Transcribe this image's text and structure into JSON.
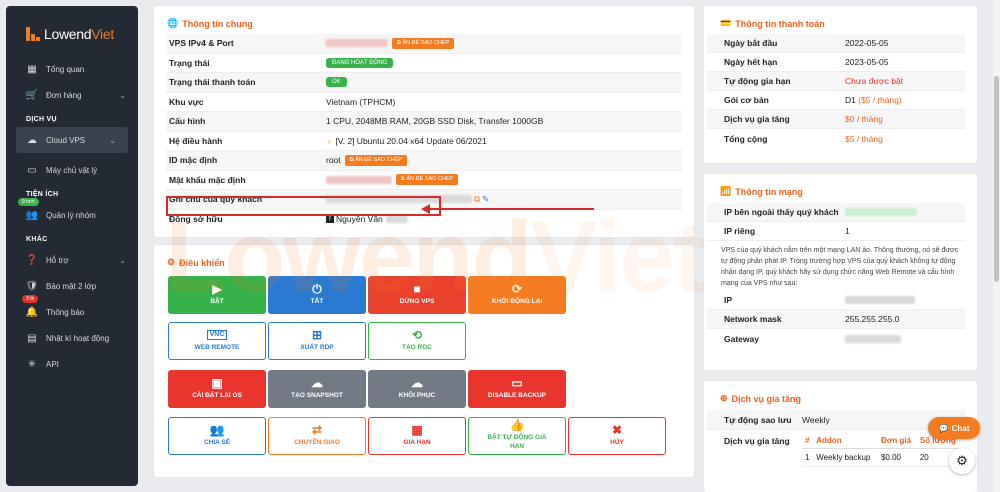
{
  "brand": {
    "name_a": "Lowend",
    "name_b": "Viet"
  },
  "sidebar": {
    "overview": "Tổng quan",
    "orders": "Đơn hàng",
    "section_services": "DỊCH VỤ",
    "cloud_vps": "Cloud VPS",
    "dedicated": "Máy chủ vật lý",
    "section_utilities": "TIỆN ÍCH",
    "group_manage": "Quản lý nhóm",
    "group_badge": "9 mới",
    "section_other": "KHÁC",
    "support": "Hỗ trợ",
    "two_factor": "Bảo mật 2 lớp",
    "notifications": "Thông báo",
    "notif_badge": "3 tb",
    "activity_log": "Nhật kí hoạt động",
    "api": "API"
  },
  "general": {
    "title": "Thông tin chung",
    "copy_label": "ẤN ĐỂ SAO CHÉP",
    "rows": {
      "ip": "VPS IPv4 & Port",
      "status": "Trạng thái",
      "status_value": "ĐANG HOẠT ĐỘNG",
      "payment": "Trạng thái thanh toán",
      "payment_value": "OK",
      "region": "Khu vực",
      "region_value": "Vietnam (TPHCM)",
      "config": "Cấu hình",
      "config_value": "1 CPU, 2048MB RAM, 20GB SSD Disk, Transfer 1000GB",
      "os": "Hệ điều hành",
      "os_value": "[V. 2] Ubuntu 20.04 x64 Update 06/2021",
      "default_id": "ID mặc định",
      "default_id_value": "root",
      "default_pw": "Mật khẩu mặc định",
      "note": "Ghi chú của quý khách",
      "owner": "Đồng sở hữu",
      "owner_value": "Nguyễn Văn"
    }
  },
  "controls": {
    "title": "Điều khiển",
    "on": "BẬT",
    "off": "TẮT",
    "stop": "DỪNG VPS",
    "restart": "KHỞI ĐỘNG LẠI",
    "web_remote": "WEB REMOTE",
    "export_rdp": "XUẤT RDP",
    "rgc": "TẠO RGC",
    "reinstall": "CÀI ĐẶT LẠI OS",
    "snapshot": "TẠO SNAPSHOT",
    "restore": "KHÔI PHỤC",
    "disable_backup": "DISABLE BACKUP",
    "share": "CHIA SẺ",
    "transfer": "CHUYỂN GIAO",
    "renew": "GIA HẠN",
    "auto_renew_a": "BẬT TỰ ĐỘNG GIA",
    "auto_renew_b": "HẠN",
    "cancel": "HỦY",
    "vnc_text": "VNC"
  },
  "payment": {
    "title": "Thông tin thanh toán",
    "start_k": "Ngày bắt đầu",
    "start_v": "2022-05-05",
    "expire_k": "Ngày hết hạn",
    "expire_v": "2023-05-05",
    "autorenew_k": "Tự động gia hạn",
    "autorenew_v": "Chưa được bật",
    "plan_k": "Gói cơ bản",
    "plan_v_a": "D1",
    "plan_v_b": "($5 / tháng)",
    "addon_k": "Dịch vụ gia tăng",
    "addon_v": "$0 / tháng",
    "total_k": "Tổng cộng",
    "total_v": "$5 / tháng"
  },
  "network": {
    "title": "Thông tin mạng",
    "public_ip_k": "IP bên ngoài thấy quý khách",
    "private_ip_k": "IP riêng",
    "private_ip_v": "1",
    "note": "VPS của quý khách nằm trên một mạng LAN ảo. Thông thường, nó sẽ được tự động phân phát IP. Trong trường hợp VPS của quý khách không tự động nhận dạng IP, quý khách hãy sử dụng chức năng Web Remote và cấu hình mạng của VPS như sau:",
    "ip_k": "IP",
    "mask_k": "Network mask",
    "mask_v": "255.255.255.0",
    "gateway_k": "Gateway"
  },
  "addons": {
    "title": "Dịch vụ gia tăng",
    "backup_k": "Tự động sao lưu",
    "backup_v": "Weekly",
    "list_k": "Dịch vụ gia tăng",
    "headers": [
      "#",
      "Addon",
      "Đơn giá",
      "Số lượng"
    ],
    "row": [
      "1",
      "Weekly backup",
      "$0.00",
      "20"
    ]
  },
  "widgets": {
    "chat": "Chat"
  },
  "colors": {
    "accent": "#f47b20",
    "sidebar": "#232a33",
    "green": "#35b24a",
    "blue": "#2a7ad2",
    "red": "#e0322f",
    "gray": "#727a86"
  }
}
